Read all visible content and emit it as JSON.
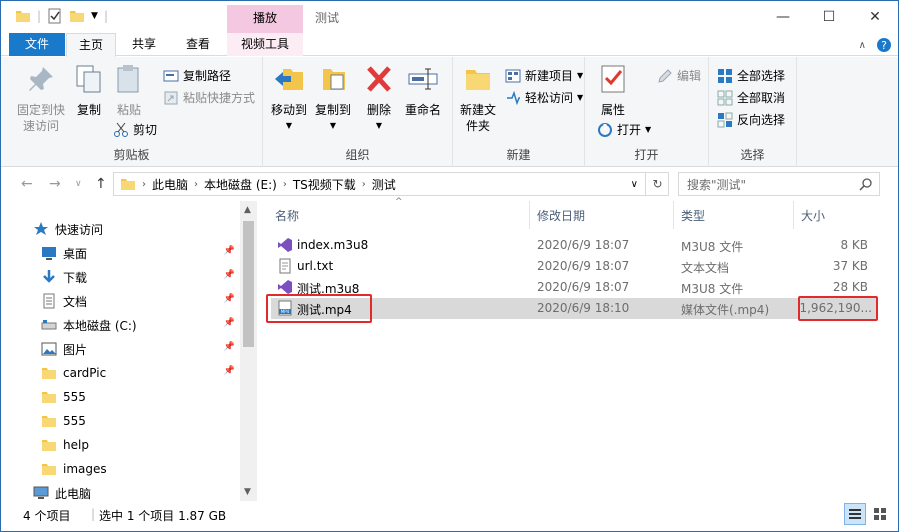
{
  "window": {
    "title": "测试",
    "context_tab": "播放",
    "controls": {
      "minimize": "—",
      "maximize": "☐",
      "close": "✕"
    }
  },
  "tabs": {
    "file": "文件",
    "home": "主页",
    "share": "共享",
    "view": "查看",
    "video": "视频工具"
  },
  "ribbon": {
    "clipboard": {
      "caption": "剪贴板",
      "pin": "固定到快速访问",
      "copy": "复制",
      "paste": "粘贴",
      "copy_path": "复制路径",
      "paste_shortcut": "粘贴快捷方式",
      "cut": "剪切"
    },
    "organize": {
      "caption": "组织",
      "move_to": "移动到",
      "copy_to": "复制到",
      "delete": "删除",
      "rename": "重命名"
    },
    "new": {
      "caption": "新建",
      "new_folder": "新建文件夹",
      "new_item": "新建项目",
      "easy_access": "轻松访问"
    },
    "open": {
      "caption": "打开",
      "properties": "属性",
      "open": "打开",
      "edit": "编辑"
    },
    "select": {
      "caption": "选择",
      "select_all": "全部选择",
      "select_none": "全部取消",
      "invert": "反向选择"
    }
  },
  "address": {
    "crumbs": [
      "此电脑",
      "本地磁盘 (E:)",
      "TS视频下载",
      "测试"
    ],
    "search_placeholder": "搜索\"测试\""
  },
  "nav": {
    "items": [
      {
        "label": "快速访问",
        "icon": "star-icon",
        "pinned": false
      },
      {
        "label": "桌面",
        "icon": "desktop-icon",
        "pinned": true
      },
      {
        "label": "下载",
        "icon": "download-icon",
        "pinned": true
      },
      {
        "label": "文档",
        "icon": "document-icon",
        "pinned": true
      },
      {
        "label": "本地磁盘 (C:)",
        "icon": "drive-icon",
        "pinned": true
      },
      {
        "label": "图片",
        "icon": "pictures-icon",
        "pinned": true
      },
      {
        "label": "cardPic",
        "icon": "folder-icon",
        "pinned": true
      },
      {
        "label": "555",
        "icon": "folder-icon",
        "pinned": false
      },
      {
        "label": "555",
        "icon": "folder-icon",
        "pinned": false
      },
      {
        "label": "help",
        "icon": "folder-icon",
        "pinned": false
      },
      {
        "label": "images",
        "icon": "folder-icon",
        "pinned": false
      },
      {
        "label": "此电脑",
        "icon": "computer-icon",
        "pinned": false
      }
    ]
  },
  "files": {
    "columns": {
      "name": "名称",
      "date": "修改日期",
      "type": "类型",
      "size": "大小"
    },
    "rows": [
      {
        "name": "index.m3u8",
        "date": "2020/6/9 18:07",
        "type": "M3U8 文件",
        "size": "8 KB",
        "icon": "vs-file-icon"
      },
      {
        "name": "url.txt",
        "date": "2020/6/9 18:07",
        "type": "文本文档",
        "size": "37 KB",
        "icon": "text-file-icon"
      },
      {
        "name": "测试.m3u8",
        "date": "2020/6/9 18:07",
        "type": "M3U8 文件",
        "size": "28 KB",
        "icon": "vs-file-icon"
      },
      {
        "name": "测试.mp4",
        "date": "2020/6/9 18:10",
        "type": "媒体文件(.mp4)",
        "size": "1,962,190...",
        "icon": "mp4-file-icon",
        "selected": true
      }
    ]
  },
  "status": {
    "count": "4 个项目",
    "selected": "选中 1 个项目  1.87 GB"
  },
  "colors": {
    "accent": "#1979ca",
    "context": "#f4c8e0",
    "highlight": "#e02b2b",
    "selection": "#d9d9d9"
  }
}
